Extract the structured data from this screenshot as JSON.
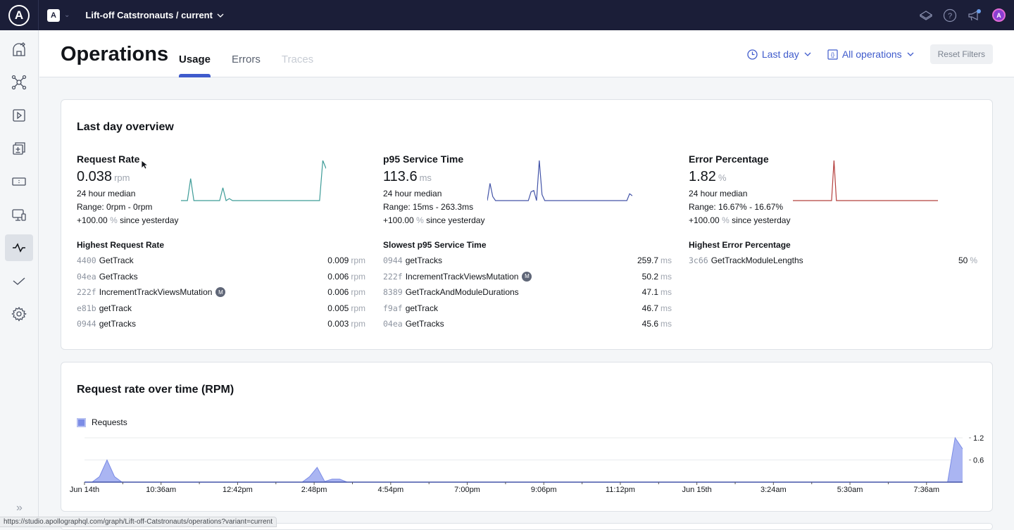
{
  "topbar": {
    "org_badge": "A",
    "graph_name": "Lift-off Catstronauts / current",
    "icons": [
      "docs-icon",
      "help-icon",
      "announcements-icon",
      "user-avatar"
    ],
    "avatar_initial": "A"
  },
  "sidebar": {
    "items": [
      {
        "name": "home",
        "icon": "observatory-icon",
        "active": false
      },
      {
        "name": "schema",
        "icon": "graph-nodes-icon",
        "active": false
      },
      {
        "name": "explorer",
        "icon": "play-icon",
        "active": false
      },
      {
        "name": "changelog",
        "icon": "diff-icon",
        "active": false
      },
      {
        "name": "fields",
        "icon": "card-icon",
        "active": false
      },
      {
        "name": "clients",
        "icon": "devices-icon",
        "active": false
      },
      {
        "name": "operations",
        "icon": "pulse-icon",
        "active": true
      },
      {
        "name": "checks",
        "icon": "check-icon",
        "active": false
      },
      {
        "name": "settings",
        "icon": "gear-icon",
        "active": false
      }
    ],
    "expand_icon": "double-chevron-right-icon"
  },
  "header": {
    "title": "Operations",
    "tabs": [
      {
        "label": "Usage",
        "state": "active"
      },
      {
        "label": "Errors",
        "state": "normal"
      },
      {
        "label": "Traces",
        "state": "disabled"
      }
    ],
    "filters": {
      "time_range": "Last day",
      "operations": "All operations",
      "reset_label": "Reset Filters"
    }
  },
  "overview": {
    "title": "Last day overview",
    "metrics": [
      {
        "title": "Request Rate",
        "value": "0.038",
        "unit": "rpm",
        "median_label": "24 hour median",
        "range": "Range: 0rpm - 0rpm",
        "change": "+100.00",
        "change_unit": "%",
        "change_suffix": "since yesterday",
        "color": "#3e9c98",
        "spark": [
          0,
          0,
          0,
          0.55,
          0,
          0,
          0,
          0,
          0,
          0,
          0,
          0,
          0,
          0.32,
          0,
          0.05,
          0,
          0,
          0,
          0,
          0,
          0,
          0,
          0,
          0,
          0,
          0,
          0,
          0,
          0,
          0,
          0,
          0,
          0,
          0,
          0,
          0,
          0,
          0,
          0,
          0,
          0,
          0,
          0,
          1,
          0.8
        ],
        "list_title": "Highest Request Rate",
        "rows": [
          {
            "id": "4400",
            "name": "GetTrack",
            "mutation": false,
            "value": "0.009",
            "unit": "rpm"
          },
          {
            "id": "04ea",
            "name": "GetTracks",
            "mutation": false,
            "value": "0.006",
            "unit": "rpm"
          },
          {
            "id": "222f",
            "name": "IncrementTrackViewsMutation",
            "mutation": true,
            "value": "0.006",
            "unit": "rpm"
          },
          {
            "id": "e81b",
            "name": "getTrack",
            "mutation": false,
            "value": "0.005",
            "unit": "rpm"
          },
          {
            "id": "0944",
            "name": "getTracks",
            "mutation": false,
            "value": "0.003",
            "unit": "rpm"
          }
        ]
      },
      {
        "title": "p95 Service Time",
        "value": "113.6",
        "unit": "ms",
        "median_label": "24 hour median",
        "range": "Range: 15ms - 263.3ms",
        "change": "+100.00",
        "change_unit": "%",
        "change_suffix": "since yesterday",
        "color": "#4354a8",
        "spark": [
          0,
          0.43,
          0.1,
          0,
          0,
          0,
          0,
          0,
          0,
          0,
          0,
          0,
          0,
          0,
          0,
          0,
          0.22,
          0.25,
          0,
          1,
          0.15,
          0,
          0,
          0,
          0,
          0,
          0,
          0,
          0,
          0,
          0,
          0,
          0,
          0,
          0,
          0,
          0,
          0,
          0,
          0,
          0,
          0,
          0,
          0,
          0,
          0,
          0,
          0,
          0,
          0,
          0,
          0,
          0.17,
          0.12
        ],
        "list_title": "Slowest p95 Service Time",
        "rows": [
          {
            "id": "0944",
            "name": "getTracks",
            "mutation": false,
            "value": "259.7",
            "unit": "ms"
          },
          {
            "id": "222f",
            "name": "IncrementTrackViewsMutation",
            "mutation": true,
            "value": "50.2",
            "unit": "ms"
          },
          {
            "id": "8389",
            "name": "GetTrackAndModuleDurations",
            "mutation": false,
            "value": "47.1",
            "unit": "ms"
          },
          {
            "id": "f9af",
            "name": "getTrack",
            "mutation": false,
            "value": "46.7",
            "unit": "ms"
          },
          {
            "id": "04ea",
            "name": "GetTracks",
            "mutation": false,
            "value": "45.6",
            "unit": "ms"
          }
        ]
      },
      {
        "title": "Error Percentage",
        "value": "1.82",
        "unit": "%",
        "median_label": "24 hour median",
        "range": "Range: 16.67% - 16.67%",
        "change": "+100.00",
        "change_unit": "%",
        "change_suffix": "since yesterday",
        "color": "#b5403e",
        "spark": [
          0,
          0,
          0,
          0,
          0,
          0,
          0,
          0,
          0,
          0,
          0,
          0,
          0,
          0,
          0,
          0,
          0,
          1,
          0,
          0,
          0,
          0,
          0,
          0,
          0,
          0,
          0,
          0,
          0,
          0,
          0,
          0,
          0,
          0,
          0,
          0,
          0,
          0,
          0,
          0,
          0,
          0,
          0,
          0,
          0,
          0,
          0,
          0,
          0,
          0,
          0,
          0,
          0,
          0,
          0,
          0,
          0,
          0,
          0,
          0,
          0
        ],
        "list_title": "Highest Error Percentage",
        "rows": [
          {
            "id": "3c66",
            "name": "GetTrackModuleLengths",
            "mutation": false,
            "value": "50",
            "unit": "%"
          }
        ]
      }
    ]
  },
  "mutation_badge": "M",
  "request_chart": {
    "title": "Request rate over time (RPM)",
    "legend": "Requests",
    "color": "#7b8ce6",
    "fill": "#aab5f2"
  },
  "chart_data": {
    "type": "area",
    "title": "Request rate over time (RPM)",
    "xlabel": "",
    "ylabel": "",
    "legend": [
      "Requests"
    ],
    "legend_position": "top-left",
    "x_ticks": [
      "Jun 14th",
      "10:36am",
      "12:42pm",
      "2:48pm",
      "4:54pm",
      "7:00pm",
      "9:06pm",
      "11:12pm",
      "Jun 15th",
      "3:24am",
      "5:30am",
      "7:36am"
    ],
    "y_ticks": [
      0.6,
      1.2
    ],
    "ylim": [
      0,
      1.25
    ],
    "grid": true,
    "series": [
      {
        "name": "Requests",
        "values": [
          0,
          0,
          0.15,
          0.6,
          0.15,
          0,
          0,
          0,
          0,
          0,
          0,
          0,
          0,
          0,
          0,
          0,
          0,
          0,
          0,
          0,
          0,
          0,
          0,
          0,
          0,
          0,
          0,
          0,
          0,
          0,
          0.15,
          0.4,
          0.02,
          0.08,
          0.08,
          0,
          0,
          0,
          0,
          0,
          0,
          0,
          0,
          0,
          0,
          0,
          0,
          0,
          0,
          0,
          0,
          0,
          0,
          0,
          0,
          0,
          0,
          0,
          0,
          0,
          0,
          0,
          0,
          0,
          0,
          0,
          0,
          0,
          0,
          0,
          0,
          0,
          0,
          0,
          0,
          0,
          0,
          0,
          0,
          0,
          0,
          0,
          0,
          0,
          0,
          0,
          0,
          0,
          0,
          0,
          0,
          0,
          0,
          0,
          0,
          0,
          0,
          0,
          0,
          0,
          0,
          0,
          0,
          0,
          0,
          0,
          0,
          0,
          0,
          0,
          0,
          0,
          0,
          0,
          0,
          0,
          1.2,
          0.9
        ]
      }
    ]
  },
  "status_url": "https://studio.apollographql.com/graph/Lift-off-Catstronauts/operations?variant=current"
}
